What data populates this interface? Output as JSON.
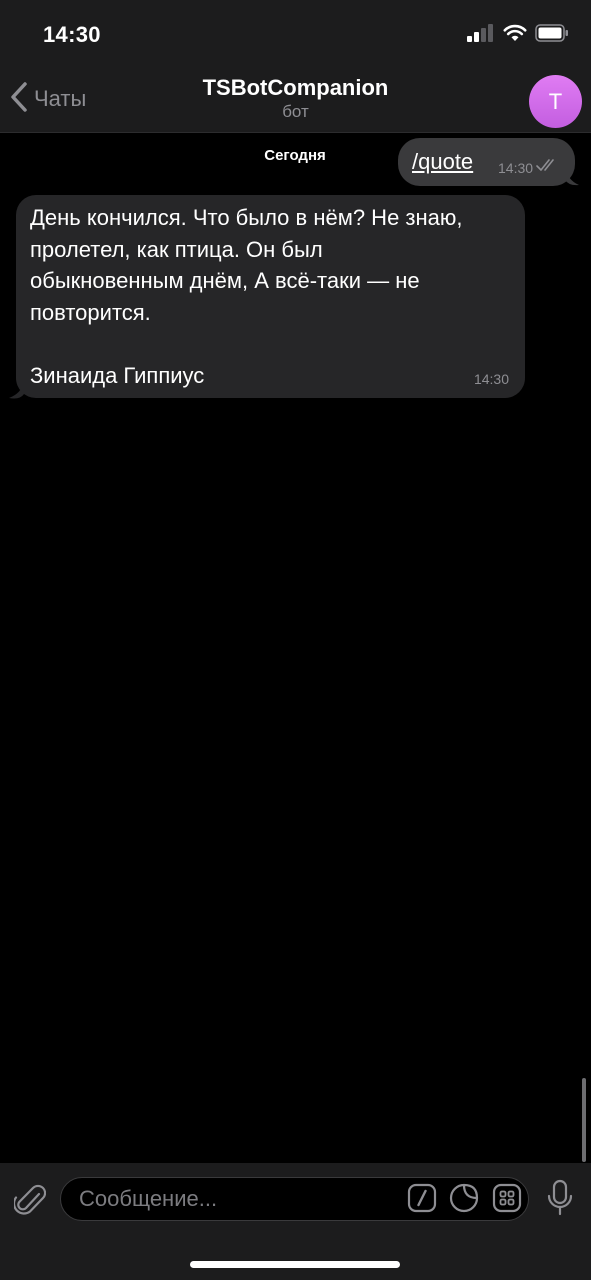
{
  "status_bar": {
    "time": "14:30"
  },
  "header": {
    "back_label": "Чаты",
    "title": "TSBotCompanion",
    "subtitle": "бот",
    "avatar_letter": "T",
    "avatar_color": "#d46ef0"
  },
  "chat": {
    "date_label": "Сегодня",
    "outgoing": {
      "text": "/quote",
      "time": "14:30",
      "status_icon": "double-check-icon"
    },
    "incoming": {
      "text": "День кончился. Что было в нём? Не знаю,\nпролетел, как птица. Он был\nобыкновенным днём, А всё-таки — не\nповторится.\n\nЗинаида Гиппиус",
      "time": "14:30"
    }
  },
  "input": {
    "placeholder": "Сообщение...",
    "icons": [
      "paperclip-icon",
      "bot-commands-icon",
      "sticker-icon",
      "bot-keyboard-icon",
      "microphone-icon"
    ]
  },
  "colors": {
    "background": "#000000",
    "bar_background": "#1c1c1d",
    "outgoing_bubble": "#3a3a3c",
    "incoming_bubble": "#262628",
    "secondary_text": "#8e8e93"
  }
}
